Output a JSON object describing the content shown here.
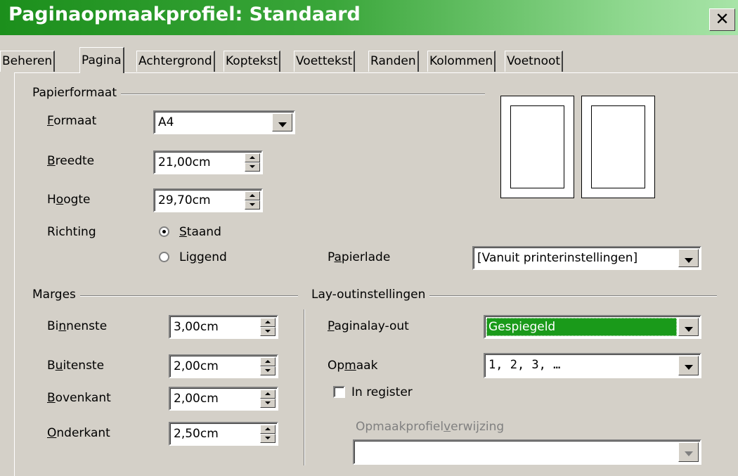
{
  "window": {
    "title": "Paginaopmaakprofiel: Standaard",
    "close": "✕"
  },
  "tabs": [
    "Beheren",
    "Pagina",
    "Achtergrond",
    "Koptekst",
    "Voettekst",
    "Randen",
    "Kolommen",
    "Voetnoot"
  ],
  "active_tab": "Pagina",
  "paper": {
    "group": "Papierformaat",
    "format_label": "Formaat",
    "format_value": "A4",
    "width_label": "Breedte",
    "width_value": "21,00cm",
    "height_label": "Hoogte",
    "height_value": "29,70cm",
    "orientation_label": "Richting",
    "portrait_label": "Staand",
    "landscape_label": "Liggend",
    "orientation_selected": "Staand",
    "tray_label": "Papierlade",
    "tray_value": "[Vanuit printerinstellingen]"
  },
  "margins": {
    "group": "Marges",
    "inner_label": "Binnenste",
    "inner_value": "3,00cm",
    "outer_label": "Buitenste",
    "outer_value": "2,00cm",
    "top_label": "Bovenkant",
    "top_value": "2,00cm",
    "bottom_label": "Onderkant",
    "bottom_value": "2,50cm"
  },
  "layout": {
    "group": "Lay-outinstellingen",
    "page_layout_label": "Paginalay-out",
    "page_layout_value": "Gespiegeld",
    "format_label": "Opmaak",
    "format_value": "1, 2, 3, …",
    "register_label": "In register",
    "register_checked": false,
    "reference_label": "Opmaakprofielverwijzing",
    "reference_value": ""
  },
  "colors": {
    "title_gradient_start": "#1c8f1c",
    "selection": "#1a9a1a",
    "face": "#d4d0c8"
  }
}
